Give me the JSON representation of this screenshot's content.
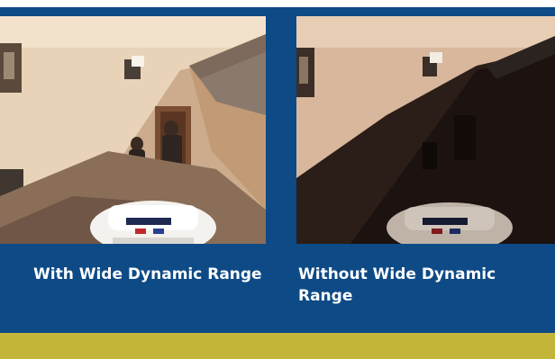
{
  "captions": {
    "with_wdr": "With Wide Dynamic Range",
    "without_wdr": "Without Wide Dynamic Range"
  },
  "colors": {
    "panel_blue": "#0e4a86",
    "accent_olive": "#c2b53a",
    "caption_text": "#ffffff"
  },
  "images": {
    "left": "photo-with-wdr",
    "right": "photo-without-wdr"
  }
}
